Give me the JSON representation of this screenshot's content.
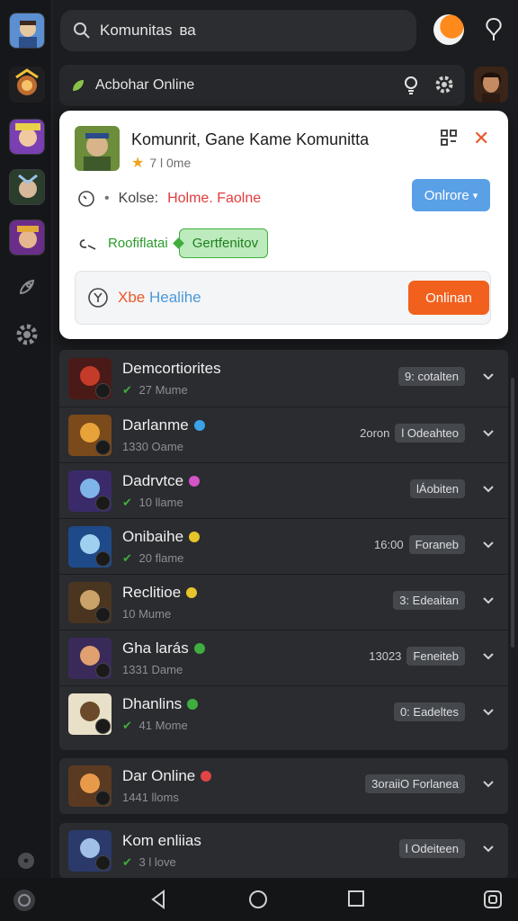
{
  "search": {
    "label": "Komunitas  ​ва"
  },
  "subheader": {
    "title": "Acbohar Online"
  },
  "card": {
    "title": "Komunrit, Gane Kame Komunitta",
    "subtitle": "7 l 0me",
    "row1_key": "Kolse:",
    "row1_value": "Holme. Faolne",
    "online_button": "Onlrore",
    "row2_value": "Roofiflatai",
    "green_pill": "Gertfenitov",
    "bottom_prefix": "Xbe ",
    "bottom_link": "Healihe",
    "bottom_button": "Onlinan"
  },
  "list": [
    {
      "name": "Demcortiorites",
      "meta": "27 Mume",
      "tag_prefix": "",
      "tag": "9: cotalten",
      "dot": "",
      "meta_check": true
    },
    {
      "name": "Darlanme",
      "meta": "1330 Oame",
      "tag_prefix": "2oron",
      "tag": "l Odeahteo",
      "dot": "#3aa2e8",
      "meta_check": false
    },
    {
      "name": "Dadrvtce",
      "meta": "10 llame",
      "tag_prefix": "",
      "tag": "lÁobiten",
      "dot": "#d454c8",
      "meta_check": true
    },
    {
      "name": "Onibaihe",
      "meta": "20 flame",
      "tag_prefix": "16:00",
      "tag": "Foraneb",
      "dot": "#e6c42a",
      "meta_check": true
    },
    {
      "name": "Reclitioe",
      "meta": "10 Mume",
      "tag_prefix": "",
      "tag": "3: Edeaitan",
      "dot": "#e6c42a",
      "meta_check": false
    },
    {
      "name": "Gha larás",
      "meta": "1331 Dame",
      "tag_prefix": "13023",
      "tag": "Feneiteb",
      "dot": "#3fae3f",
      "meta_check": false
    },
    {
      "name": "Dhanlins",
      "meta": "41 Mome",
      "tag_prefix": "",
      "tag": "0: Eadeltes",
      "dot": "#3fae3f",
      "meta_check": true
    },
    {
      "name": "Dar Online",
      "meta": "1441 lloms",
      "tag_prefix": "",
      "tag": "3oraiiO Forlanea",
      "dot": "#e04444",
      "meta_check": false
    },
    {
      "name": "Kom enliias",
      "meta": "3 l love",
      "tag_prefix": "",
      "tag": "l Odeiteen",
      "dot": "",
      "meta_check": true
    }
  ],
  "colors": {
    "accent_blue": "#5aa0e6",
    "accent_orange": "#f2601e",
    "accent_green": "#3fae3f"
  }
}
